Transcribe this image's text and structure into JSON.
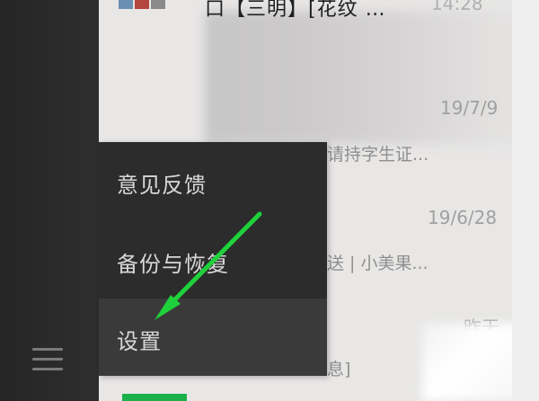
{
  "sidebar": {
    "menu_icon": "hamburger-menu-icon"
  },
  "chat_list": {
    "top_chat": {
      "title": "口【三明】[花纹 …",
      "time": "14:28"
    },
    "items": [
      {
        "time": "19/7/9",
        "preview": "请持字生证..."
      },
      {
        "time": "19/6/28",
        "preview": "送 | 小美果..."
      },
      {
        "time": "昨天",
        "preview": "息]"
      }
    ],
    "mute_icon": "muted-bell-icon"
  },
  "popup_menu": {
    "items": [
      {
        "label": "意见反馈"
      },
      {
        "label": "备份与恢复"
      },
      {
        "label": "设置"
      }
    ],
    "highlighted": "设置"
  },
  "annotation": {
    "arrow_color": "#1fd13a"
  },
  "colors": {
    "sidebar": "#2b2b2b",
    "menu_bg": "#2c2c2c",
    "menu_highlight": "#3a3a3a",
    "accent_green": "#1ab04a"
  }
}
